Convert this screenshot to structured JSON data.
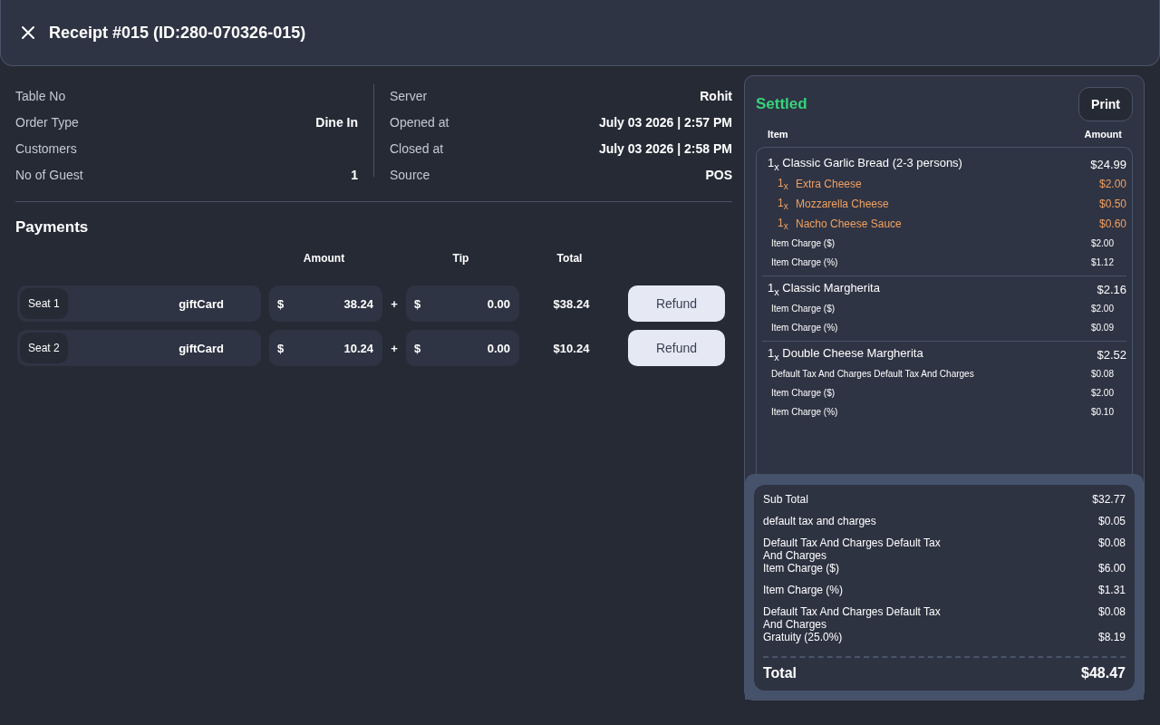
{
  "header": {
    "title": "Receipt #015 (ID:280-070326-015)"
  },
  "details_left": [
    {
      "label": "Table No"
    },
    {
      "label": "Order Type",
      "value": "Dine In"
    },
    {
      "label": "Customers"
    },
    {
      "label": "No of Guest",
      "value": "1"
    }
  ],
  "details_right": [
    {
      "label": "Server",
      "value": "Rohit"
    },
    {
      "label": "Opened at",
      "value": "July 03 2026 | 2:57 PM"
    },
    {
      "label": "Closed at",
      "value": "July 03 2026 | 2:58 PM"
    },
    {
      "label": "Source",
      "value": "POS"
    }
  ],
  "payments": {
    "title": "Payments",
    "columns": [
      "Amount",
      "Tip",
      "Total"
    ],
    "rows": [
      {
        "seat": "Seat 1",
        "method": "giftCard",
        "amount_currency": "$",
        "amount": "38.24",
        "plus": "+",
        "tip_currency": "$",
        "tip": "0.00",
        "total": "$38.24",
        "button": "Refund"
      },
      {
        "seat": "Seat 2",
        "method": "giftCard",
        "amount_currency": "$",
        "amount": "10.24",
        "plus": "+",
        "tip_currency": "$",
        "tip": "0.00",
        "total": "$10.24",
        "button": "Refund"
      }
    ]
  },
  "receipt": {
    "status": "Settled",
    "print_button": "Print",
    "columns": [
      "Item",
      "Amount"
    ],
    "items": [
      {
        "qty": "1$_{x}$",
        "name": "Classic Garlic Bread (2-3 persons)",
        "price": "$24.99",
        "modifiers": [
          {
            "qty": "1$_{x}$",
            "name": "Extra Cheese",
            "price": "$2.00"
          },
          {
            "qty": "1$_{x}$",
            "name": "Mozzarella Cheese",
            "price": "$0.50"
          },
          {
            "qty": "1$_{x}$",
            "name": "Nacho Cheese Sauce",
            "price": "$0.60"
          }
        ],
        "charges": [
          {
            "label": "Item Charge ($)",
            "amount": "$2.00"
          },
          {
            "label": "Item Charge (%)",
            "amount": "$1.12"
          }
        ]
      },
      {
        "qty": "1$_{x}$",
        "name": "Classic Margherita",
        "price": "$2.16",
        "charges": [
          {
            "label": "Item Charge ($)",
            "amount": "$2.00"
          },
          {
            "label": "Item Charge (%)",
            "amount": "$0.09"
          }
        ]
      },
      {
        "qty": "1$_{x}$",
        "name": "Double Cheese Margherita",
        "price": "$2.52",
        "charges": [
          {
            "label": "Default Tax And Charges Default Tax And Charges",
            "amount": "$0.08"
          },
          {
            "label": "Item Charge ($)",
            "amount": "$2.00"
          },
          {
            "label": "Item Charge (%)",
            "amount": "$0.10"
          }
        ]
      }
    ],
    "summary": [
      {
        "label": "Sub Total",
        "amount": "$32.77"
      },
      {
        "label": "default tax and charges",
        "amount": "$0.05"
      },
      {
        "label": "Default Tax And Charges Default Tax And Charges",
        "amount": "$0.08"
      },
      {
        "label": "Item Charge ($)",
        "amount": "$6.00"
      },
      {
        "label": "Item Charge (%)",
        "amount": "$1.31"
      },
      {
        "label": "Default Tax And Charges Default Tax And Charges",
        "amount": "$0.08"
      },
      {
        "label": "Gratuity (25.0%)",
        "amount": "$8.19"
      }
    ],
    "total": {
      "label": "Total",
      "amount": "$48.47"
    }
  }
}
